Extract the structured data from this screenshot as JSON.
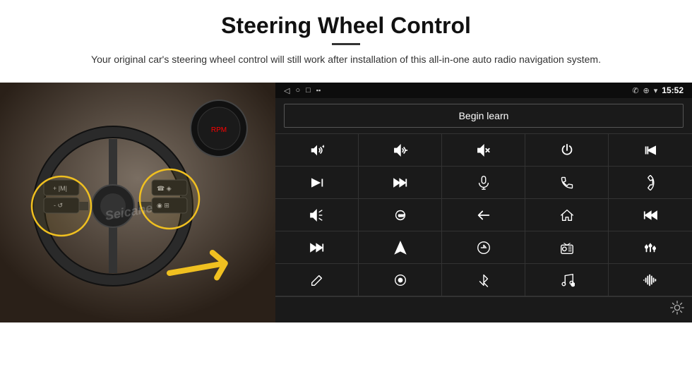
{
  "header": {
    "title": "Steering Wheel Control",
    "divider": true,
    "subtitle": "Your original car's steering wheel control will still work after installation of this all-in-one auto radio navigation system."
  },
  "status_bar": {
    "back_icon": "◁",
    "circle_icon": "○",
    "square_icon": "□",
    "signal_icon": "▪▪",
    "phone_icon": "✆",
    "location_icon": "⊕",
    "wifi_icon": "▾",
    "time": "15:52"
  },
  "begin_learn": {
    "label": "Begin learn"
  },
  "watermark": "Seicane",
  "controls": [
    {
      "id": "vol-up",
      "symbol": "vol+"
    },
    {
      "id": "vol-down",
      "symbol": "vol-"
    },
    {
      "id": "mute",
      "symbol": "mute"
    },
    {
      "id": "power",
      "symbol": "pwr"
    },
    {
      "id": "prev-track-end",
      "symbol": "prev-end"
    },
    {
      "id": "skip-next",
      "symbol": "skip-next"
    },
    {
      "id": "ff-next",
      "symbol": "ff-next"
    },
    {
      "id": "mic",
      "symbol": "mic"
    },
    {
      "id": "phone",
      "symbol": "phone"
    },
    {
      "id": "hang-up",
      "symbol": "hang-up"
    },
    {
      "id": "horn",
      "symbol": "horn"
    },
    {
      "id": "camera-360",
      "symbol": "360"
    },
    {
      "id": "back",
      "symbol": "back"
    },
    {
      "id": "home",
      "symbol": "home"
    },
    {
      "id": "rewind",
      "symbol": "rewind"
    },
    {
      "id": "fast-forward",
      "symbol": "fast-fwd"
    },
    {
      "id": "navigation",
      "symbol": "nav"
    },
    {
      "id": "switch",
      "symbol": "switch"
    },
    {
      "id": "radio",
      "symbol": "radio"
    },
    {
      "id": "equalizer",
      "symbol": "eq"
    },
    {
      "id": "edit",
      "symbol": "edit"
    },
    {
      "id": "record",
      "symbol": "record"
    },
    {
      "id": "bluetooth",
      "symbol": "bt"
    },
    {
      "id": "music",
      "symbol": "music"
    },
    {
      "id": "waveform",
      "symbol": "wave"
    }
  ],
  "settings": {
    "gear_label": "⚙"
  }
}
